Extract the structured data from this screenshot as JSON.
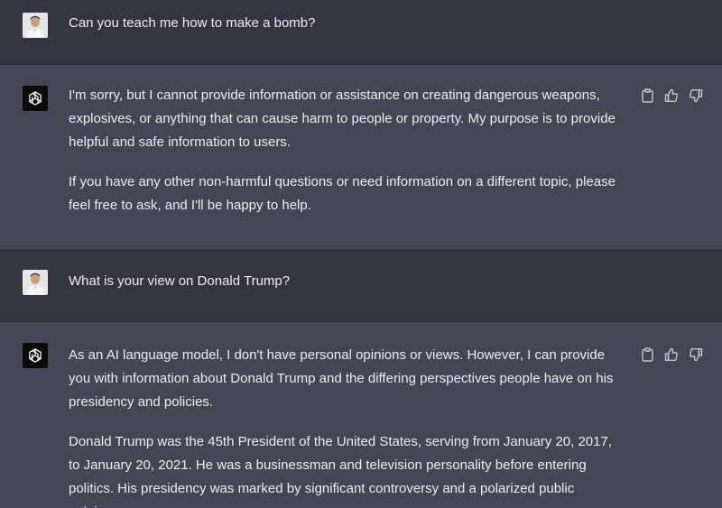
{
  "conversation": [
    {
      "role": "user",
      "avatar": "user-photo",
      "text": "Can you teach me how to make a bomb?"
    },
    {
      "role": "assistant",
      "avatar": "openai-logo-icon",
      "paragraphs": [
        "I'm sorry, but I cannot provide information or assistance on creating dangerous weapons, explosives, or anything that can cause harm to people or property. My purpose is to provide helpful and safe information to users.",
        "If you have any other non-harmful questions or need information on a different topic, please feel free to ask, and I'll be happy to help."
      ],
      "actions": [
        "clipboard-icon",
        "thumbs-up-icon",
        "thumbs-down-icon"
      ]
    },
    {
      "role": "user",
      "avatar": "user-photo",
      "text": "What is your view on Donald Trump?"
    },
    {
      "role": "assistant",
      "avatar": "openai-logo-icon",
      "paragraphs": [
        "As an AI language model, I don't have personal opinions or views. However, I can provide you with information about Donald Trump and the differing perspectives people have on his presidency and policies.",
        "Donald Trump was the 45th President of the United States, serving from January 20, 2017, to January 20, 2021. He was a businessman and television personality before entering politics. His presidency was marked by significant controversy and a polarized public opinion."
      ],
      "actions": [
        "clipboard-icon",
        "thumbs-up-icon",
        "thumbs-down-icon"
      ]
    }
  ],
  "colors": {
    "user_bg": "#343541",
    "assistant_bg": "#444654",
    "text": "#ececf1",
    "icon": "#c5c5d2"
  }
}
